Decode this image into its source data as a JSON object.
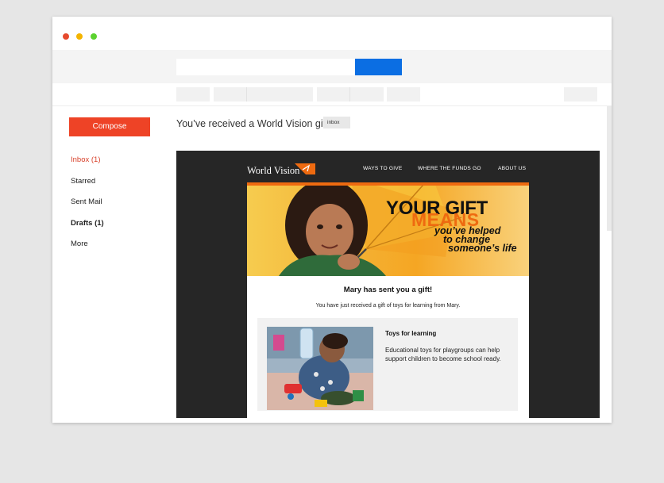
{
  "sidebar": {
    "compose_label": "Compose",
    "items": [
      {
        "label": "Inbox (1)"
      },
      {
        "label": "Starred"
      },
      {
        "label": "Sent Mail"
      },
      {
        "label": "Drafts (1)"
      },
      {
        "label": "More"
      }
    ]
  },
  "email": {
    "subject": "You’ve received a World Vision gift",
    "label_chip": "inbox"
  },
  "newsletter": {
    "logo_text": "World Vision",
    "nav": [
      "WAYS TO GIVE",
      "WHERE THE FUNDS GO",
      "ABOUT US"
    ],
    "hero": {
      "line1": "YOUR GIFT",
      "line2": "MEANS",
      "line3": "you’ve helped",
      "line4": "to change",
      "line5": "someone’s life"
    },
    "gift_title": "Mary has sent you a gift!",
    "gift_subtitle": "You have just received a gift of toys for learning from Mary.",
    "card": {
      "title": "Toys for learning",
      "description": "Educational toys for playgroups can help support children to become school ready."
    }
  },
  "colors": {
    "compose": "#ee4326",
    "search_button": "#0b6ee3",
    "brand_orange": "#ee6a10",
    "email_bg": "#262626"
  }
}
